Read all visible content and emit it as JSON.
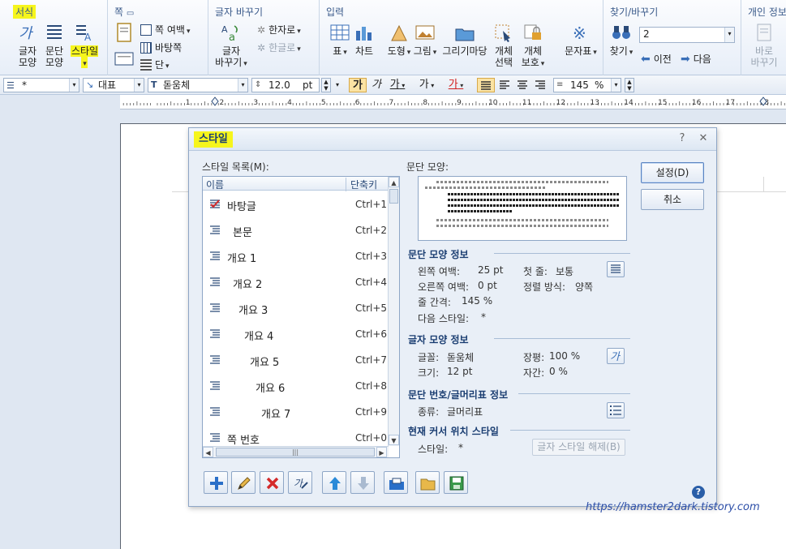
{
  "ribbon": {
    "groups": {
      "format": {
        "title": "서식"
      },
      "page": {
        "title": "쪽"
      },
      "convert": {
        "title": "글자 바꾸기"
      },
      "insert": {
        "title": "입력"
      },
      "find": {
        "title": "찾기/바꾸기"
      },
      "personal": {
        "title": "개인 정보"
      }
    },
    "buttons": {
      "char_shape": "글자\n모양",
      "para_shape": "문단\n모양",
      "style": "스타일",
      "page": "쪽",
      "page_margin": "쪽 여백",
      "background": "바탕쪽",
      "columns": "단",
      "char_convert": "글자\n바꾸기",
      "to_hanja": "한자로",
      "to_hangul": "한글로",
      "table": "표",
      "chart": "차트",
      "shape": "도형",
      "picture": "그림",
      "clipart": "그리기마당",
      "obj_select": "개체\n선택",
      "obj_protect": "개체\n보호",
      "symbols": "문자표",
      "find": "찾기",
      "find_value": "2",
      "prev": "이전",
      "next": "다음",
      "quick_replace": "바로\n바꾸기"
    }
  },
  "format_bar": {
    "style_value": "*",
    "lang_value": "대표",
    "font_value": "돋움체",
    "size_value": "12.0",
    "size_unit": "pt",
    "bold": "가",
    "italic": "가",
    "underline": "가",
    "strike": "가",
    "color": "가",
    "line_spacing": "145",
    "line_spacing_unit": "%"
  },
  "ruler": {
    "numbers": [
      "1",
      "2",
      "3",
      "4",
      "5",
      "6",
      "7",
      "8",
      "9",
      "10",
      "11",
      "12",
      "13",
      "14",
      "15",
      "16",
      "17",
      "18"
    ]
  },
  "dialog": {
    "title": "스타일",
    "style_list_label": "스타일 목록(M):",
    "col_name": "이름",
    "col_shortcut": "단축키",
    "styles": [
      {
        "name": "바탕글",
        "key": "Ctrl+1",
        "indent": 0
      },
      {
        "name": "본문",
        "key": "Ctrl+2",
        "indent": 1
      },
      {
        "name": "개요 1",
        "key": "Ctrl+3",
        "indent": 0
      },
      {
        "name": "개요 2",
        "key": "Ctrl+4",
        "indent": 1
      },
      {
        "name": "개요 3",
        "key": "Ctrl+5",
        "indent": 2
      },
      {
        "name": "개요 4",
        "key": "Ctrl+6",
        "indent": 3
      },
      {
        "name": "개요 5",
        "key": "Ctrl+7",
        "indent": 4
      },
      {
        "name": "개요 6",
        "key": "Ctrl+8",
        "indent": 5
      },
      {
        "name": "개요 7",
        "key": "Ctrl+9",
        "indent": 6
      },
      {
        "name": "쪽 번호",
        "key": "Ctrl+0",
        "indent": 0
      }
    ],
    "preview_label": "문단 모양:",
    "para_info": {
      "title": "문단 모양 정보",
      "left_margin_label": "왼쪽 여백:",
      "left_margin_value": "25 pt",
      "first_line_label": "첫 줄:",
      "first_line_value": "보통",
      "right_margin_label": "오른쪽 여백:",
      "right_margin_value": "0 pt",
      "align_label": "정렬 방식:",
      "align_value": "양쪽",
      "line_spacing_label": "줄 간격:",
      "line_spacing_value": "145 %",
      "next_style_label": "다음 스타일:",
      "next_style_value": "*"
    },
    "char_info": {
      "title": "글자 모양 정보",
      "font_label": "글꼴:",
      "font_value": "돋움체",
      "ratio_label": "장평:",
      "ratio_value": "100 %",
      "size_label": "크기:",
      "size_value": "12 pt",
      "spacing_label": "자간:",
      "spacing_value": "0 %"
    },
    "bullet_info": {
      "title": "문단 번호/글머리표 정보",
      "type_label": "종류:",
      "type_value": "글머리표"
    },
    "cursor_info": {
      "title": "현재 커서 위치 스타일",
      "style_label": "스타일:",
      "style_value": "*",
      "release_button": "글자 스타일 해제(B)"
    },
    "ok_button": "설정(D)",
    "cancel_button": "취소",
    "help": "?"
  },
  "watermark": "https://hamster2dark.tistory.com"
}
